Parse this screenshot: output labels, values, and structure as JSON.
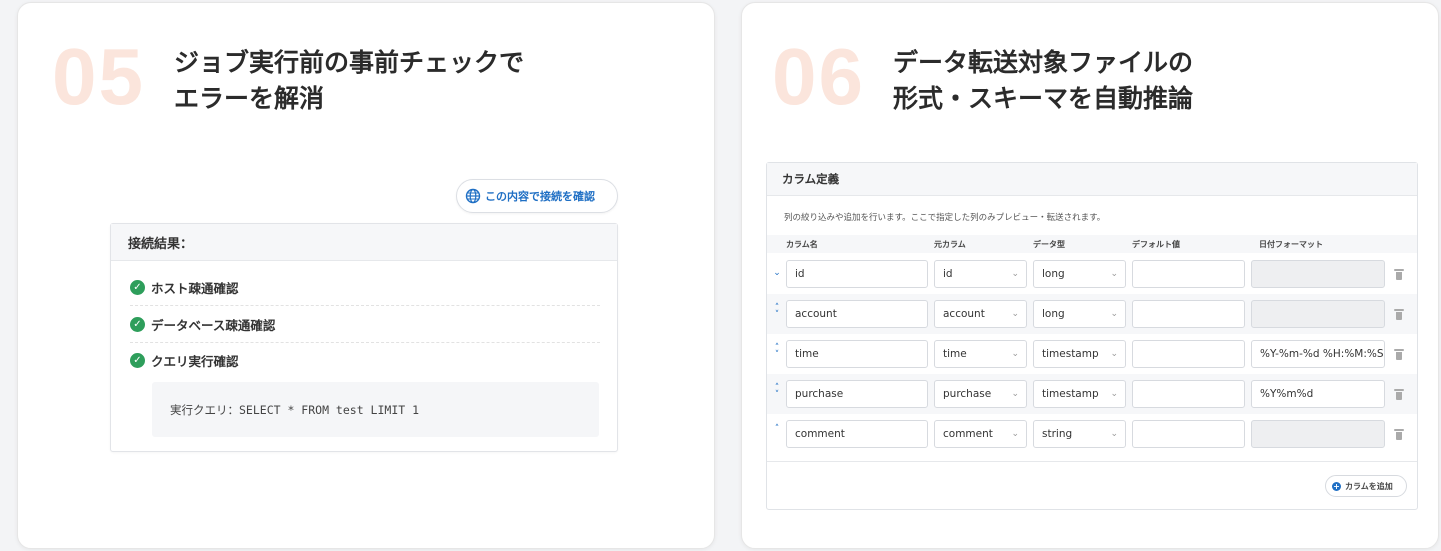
{
  "left_card": {
    "number": "05",
    "title_line1": "ジョブ実行前の事前チェックで",
    "title_line2": "エラーを解消",
    "check_button": "この内容で接続を確認",
    "result_title": "接続結果：",
    "results": [
      {
        "label": "ホスト疎通確認"
      },
      {
        "label": "データベース疎通確認"
      },
      {
        "label": "クエリ実行確認"
      }
    ],
    "query_text": "実行クエリ：SELECT * FROM test LIMIT 1"
  },
  "right_card": {
    "number": "06",
    "title_line1": "データ転送対象ファイルの",
    "title_line2": "形式・スキーマを自動推論",
    "panel_title": "カラム定義",
    "description": "列の絞り込みや追加を行います。ここで指定した列のみプレビュー・転送されます。",
    "columns": [
      "カラム名",
      "元カラム",
      "データ型",
      "デフォルト値",
      "日付フォーマット"
    ],
    "rows": [
      {
        "control": "down",
        "name": "id",
        "source": "id",
        "type": "long",
        "default": "",
        "format": "",
        "format_disabled": true
      },
      {
        "control": "both",
        "name": "account",
        "source": "account",
        "type": "long",
        "default": "",
        "format": "",
        "format_disabled": true
      },
      {
        "control": "both",
        "name": "time",
        "source": "time",
        "type": "timestamp",
        "default": "",
        "format": "%Y-%m-%d %H:%M:%S",
        "format_disabled": false
      },
      {
        "control": "both",
        "name": "purchase",
        "source": "purchase",
        "type": "timestamp",
        "default": "",
        "format": "%Y%m%d",
        "format_disabled": false
      },
      {
        "control": "up",
        "name": "comment",
        "source": "comment",
        "type": "string",
        "default": "",
        "format": "",
        "format_disabled": true
      }
    ],
    "add_button": "カラムを追加"
  },
  "colors": {
    "accent": "#1f6fc4",
    "success": "#2e9e5b",
    "number_tint": "#fbe5dc"
  }
}
